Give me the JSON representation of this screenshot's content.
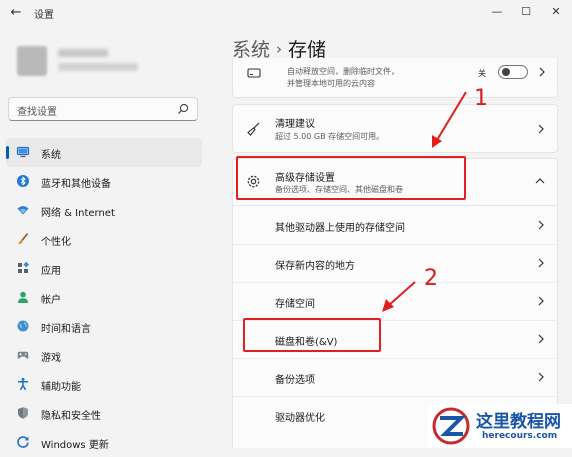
{
  "window": {
    "title": "设置",
    "back_glyph": "←",
    "min_glyph": "—",
    "max_glyph": "☐",
    "close_glyph": "✕"
  },
  "search": {
    "placeholder": "查找设置"
  },
  "nav": [
    {
      "label": "系统",
      "icon": "monitor-icon",
      "selected": true
    },
    {
      "label": "蓝牙和其他设备",
      "icon": "bluetooth-icon"
    },
    {
      "label": "网络 & Internet",
      "icon": "wifi-icon"
    },
    {
      "label": "个性化",
      "icon": "paint-brush-icon"
    },
    {
      "label": "应用",
      "icon": "apps-icon"
    },
    {
      "label": "帐户",
      "icon": "account-icon"
    },
    {
      "label": "时间和语言",
      "icon": "globe-clock-icon"
    },
    {
      "label": "游戏",
      "icon": "gamepad-icon"
    },
    {
      "label": "辅助功能",
      "icon": "accessibility-icon"
    },
    {
      "label": "隐私和安全性",
      "icon": "shield-icon"
    },
    {
      "label": "Windows 更新",
      "icon": "windows-update-icon"
    }
  ],
  "breadcrumb": {
    "parent": "系统",
    "separator": "›",
    "current": "存储"
  },
  "top_card": {
    "line1": "自动释放空间，删除临时文件，",
    "line2": "并管理本地可用的云内容",
    "toggle_label": "关"
  },
  "cleanup": {
    "title": "清理建议",
    "subtitle": "超过 5.00 GB 存储空间可用。"
  },
  "advanced": {
    "title": "高级存储设置",
    "subtitle": "备份选项、存储空间、其他磁盘和卷"
  },
  "sub_items": [
    "其他驱动器上使用的存储空间",
    "保存新内容的地方",
    "存储空间",
    "磁盘和卷(&V)",
    "备份选项",
    "驱动器优化"
  ],
  "annotations": {
    "one": "1",
    "two": "2"
  },
  "colors": {
    "accent": "#005fb8",
    "annotation_red": "#e02020",
    "watermark_blue": "#1a56a8"
  },
  "watermark": {
    "title": "这里教程网",
    "url": "herecours.com"
  }
}
